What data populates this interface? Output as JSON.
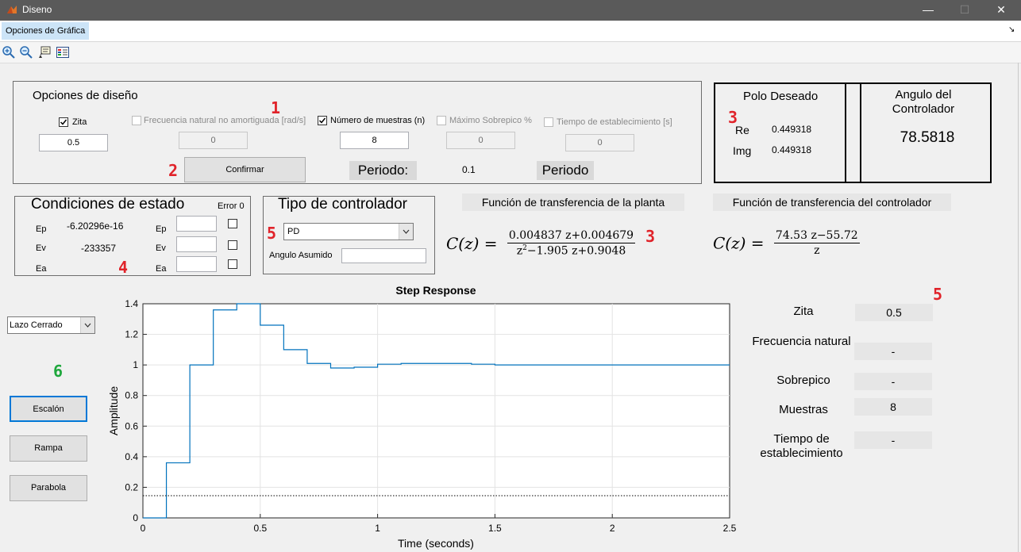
{
  "window": {
    "title": "Diseno",
    "minimize": "—",
    "maximize": "☐",
    "close": "✕"
  },
  "menu": {
    "item": "Opciones de Gráfica",
    "corner": "↘"
  },
  "toolbar": {
    "icons": [
      "zoom-in-icon",
      "zoom-out-icon",
      "data-cursor-icon",
      "legend-icon"
    ]
  },
  "design": {
    "title": "Opciones de diseño",
    "zita_label": "Zita",
    "zita_value": "0.5",
    "freq_label": "Frecuencia natural no amortiguada [rad/s]",
    "freq_value": "0",
    "samples_label": "Número de muestras (n)",
    "samples_value": "8",
    "overshoot_label": "Máximo Sobrepico %",
    "overshoot_value": "0",
    "settling_label": "Tiempo de establecimiento [s]",
    "settling_value": "0",
    "confirm": "Confirmar",
    "period_label": "Periodo:",
    "period_value": "0.1",
    "period_label2": "Periodo"
  },
  "pole": {
    "title": "Polo Deseado",
    "re_label": "Re",
    "re_value": "0.449318",
    "img_label": "Img",
    "img_value": "0.449318"
  },
  "angle": {
    "title": "Angulo del Controlador",
    "value": "78.5818"
  },
  "state": {
    "title": "Condiciones de estado",
    "error_label": "Error 0",
    "ep_label": "Ep",
    "ep_value": "-6.20296e-16",
    "ev_label": "Ev",
    "ev_value": "-233357",
    "ea_label": "Ea",
    "ea_value": ""
  },
  "controller": {
    "title": "Tipo de controlador",
    "selected": "PD",
    "angle_label": "Angulo Asumido",
    "angle_value": ""
  },
  "plant_tf": {
    "title": "Función de transferencia de la planta",
    "lhs": "C(z) =",
    "num": "0.004837 z+0.004679",
    "den_a": "z",
    "den_exp": "2",
    "den_b": "−1.905 z+0.9048"
  },
  "ctrl_tf": {
    "title": "Función de transferencia del controlador",
    "lhs": "C(z) =",
    "num": "74.53 z−55.72",
    "den": "z"
  },
  "loop": {
    "selected": "Lazo Cerrado"
  },
  "buttons": {
    "step": "Escalón",
    "ramp": "Rampa",
    "parabola": "Parabola"
  },
  "annotations": {
    "a1": "1",
    "a2": "2",
    "a3a": "3",
    "a3b": "3",
    "a4": "4",
    "a5a": "5",
    "a5b": "5",
    "a6": "6"
  },
  "results": {
    "zita_label": "Zita",
    "zita_value": "0.5",
    "freq_label": "Frecuencia natural",
    "freq_value": "-",
    "overshoot_label": "Sobrepico",
    "overshoot_value": "-",
    "samples_label": "Muestras",
    "samples_value": "8",
    "settling_label": "Tiempo de establecimiento",
    "settling_value": "-"
  },
  "chart_data": {
    "type": "line",
    "title": "Step Response",
    "xlabel": "Time (seconds)",
    "ylabel": "Amplitude",
    "xlim": [
      0,
      2.5
    ],
    "ylim": [
      0,
      1.4
    ],
    "xticks": [
      "0",
      "0.5",
      "1",
      "1.5",
      "2",
      "2.5"
    ],
    "yticks": [
      "0",
      "0.2",
      "0.4",
      "0.6",
      "0.8",
      "1",
      "1.2",
      "1.4"
    ],
    "grid": true,
    "series": [
      {
        "style": "stairs",
        "color": "#0072bd",
        "x": [
          0,
          0.1,
          0.2,
          0.3,
          0.4,
          0.5,
          0.6,
          0.7,
          0.8,
          0.9,
          1.0,
          1.1,
          1.2,
          1.3,
          1.4,
          1.5,
          2.5
        ],
        "y": [
          0,
          0.36,
          1.0,
          1.36,
          1.4,
          1.26,
          1.1,
          1.01,
          0.98,
          0.985,
          1.005,
          1.01,
          1.01,
          1.01,
          1.005,
          1.0,
          1.0
        ]
      },
      {
        "style": "dotted",
        "color": "#000000",
        "x": [
          0,
          2.5
        ],
        "y": [
          0.145,
          0.145
        ]
      }
    ]
  }
}
